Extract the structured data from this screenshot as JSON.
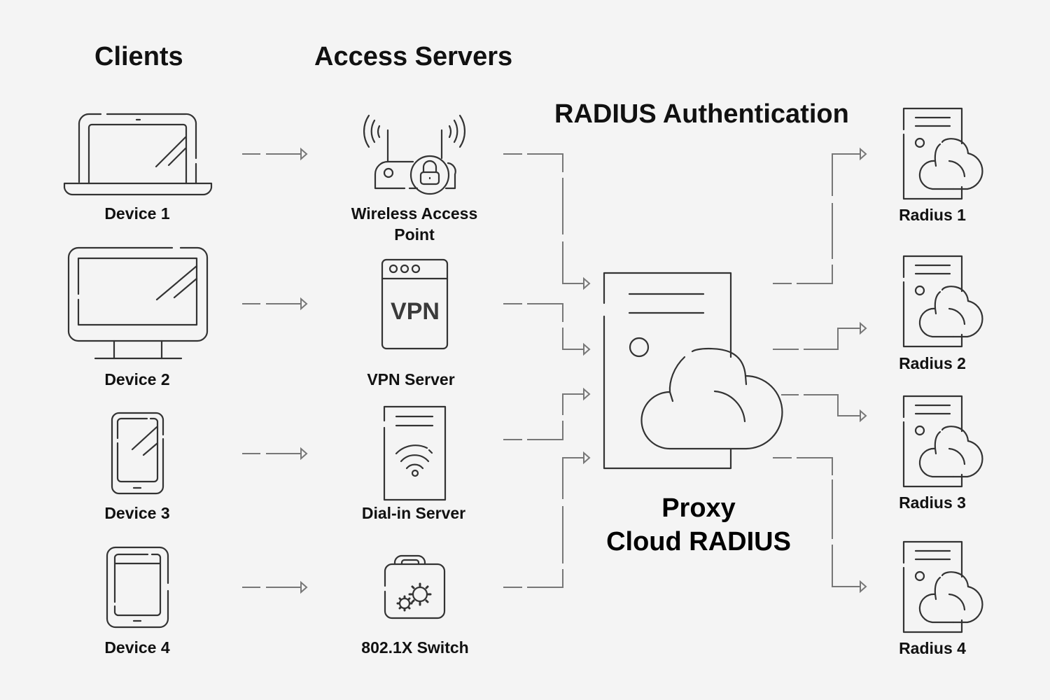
{
  "headings": {
    "clients": "Clients",
    "access_servers": "Access Servers",
    "radius_auth": "RADIUS Authentication"
  },
  "clients": [
    {
      "label": "Device 1",
      "icon": "laptop-icon"
    },
    {
      "label": "Device 2",
      "icon": "monitor-icon"
    },
    {
      "label": "Device 3",
      "icon": "phone-icon"
    },
    {
      "label": "Device 4",
      "icon": "tablet-icon"
    }
  ],
  "access_servers": [
    {
      "label_line1": "Wireless Access",
      "label_line2": "Point",
      "icon": "wireless-router-lock-icon"
    },
    {
      "label": "VPN Server",
      "icon": "vpn-window-icon",
      "icon_text": "VPN"
    },
    {
      "label": "Dial-in Server",
      "icon": "dialin-server-wifi-icon"
    },
    {
      "label": "802.1X Switch",
      "icon": "lock-gears-icon"
    }
  ],
  "proxy": {
    "line1": "Proxy",
    "line2": "Cloud RADIUS",
    "icon": "cloud-server-icon"
  },
  "radius_servers": [
    {
      "label": "Radius 1",
      "icon": "cloud-server-icon"
    },
    {
      "label": "Radius 2",
      "icon": "cloud-server-icon"
    },
    {
      "label": "Radius 3",
      "icon": "cloud-server-icon"
    },
    {
      "label": "Radius 4",
      "icon": "cloud-server-icon"
    }
  ],
  "colors": {
    "background": "#f4f4f4",
    "icon_stroke": "#333333",
    "connector": "#777777",
    "text": "#111111"
  }
}
